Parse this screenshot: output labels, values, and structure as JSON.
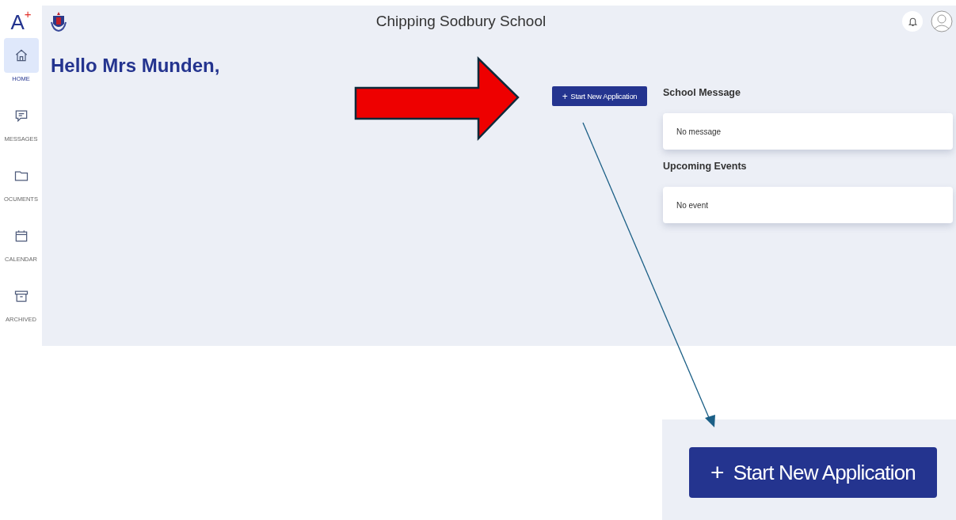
{
  "logo": {
    "letter": "A",
    "superscript": "+"
  },
  "sidebar": {
    "items": [
      {
        "kind": "home",
        "label": "HOME",
        "selected": true
      },
      {
        "kind": "messages",
        "label": "MESSAGES",
        "selected": false
      },
      {
        "kind": "documents",
        "label": "OCUMENTS",
        "selected": false
      },
      {
        "kind": "calendar",
        "label": "CALENDAR",
        "selected": false
      },
      {
        "kind": "archived",
        "label": "ARCHIVED",
        "selected": false
      }
    ]
  },
  "header": {
    "title": "Chipping Sodbury School"
  },
  "greeting": "Hello Mrs Munden,",
  "start_button": {
    "icon": "+",
    "label": "Start New Application"
  },
  "panels": [
    {
      "title": "School Message",
      "body": "No message"
    },
    {
      "title": "Upcoming Events",
      "body": "No event"
    }
  ],
  "zoom_inset": {
    "icon": "+",
    "label": "Start New Application"
  }
}
